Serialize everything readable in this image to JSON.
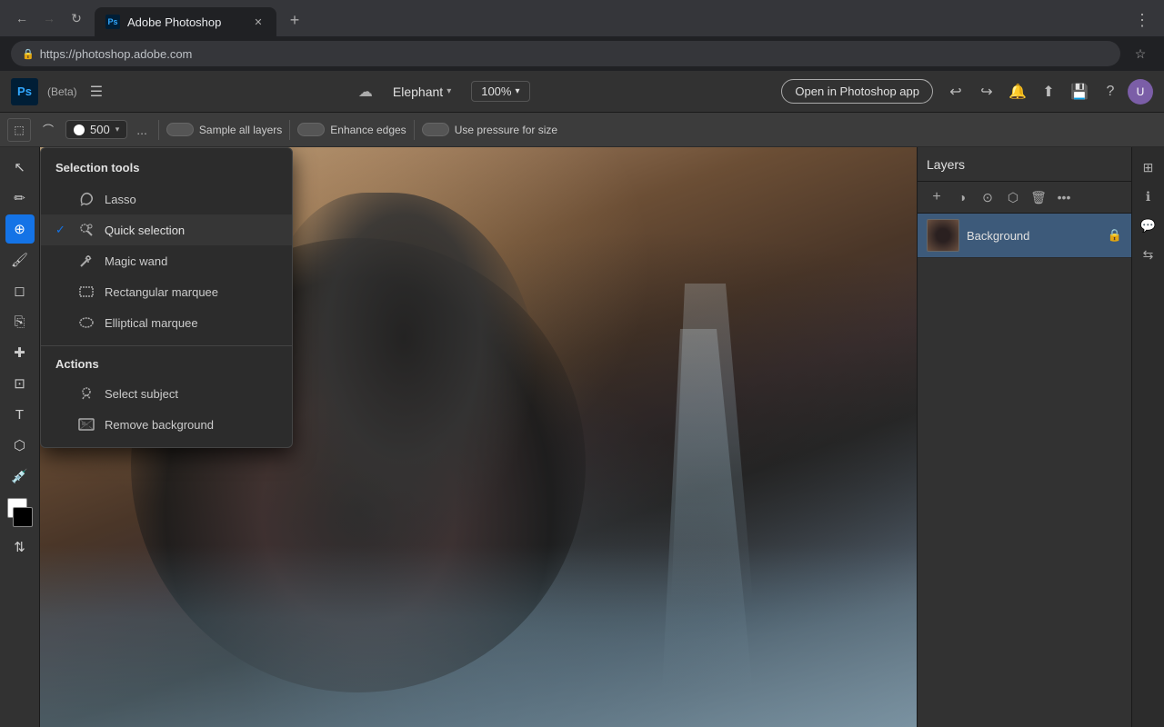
{
  "browser": {
    "tab_title": "Adobe Photoshop",
    "tab_favicon": "Ps",
    "url": "https://photoshop.adobe.com",
    "new_tab_label": "+"
  },
  "app_header": {
    "ps_logo": "Ps",
    "beta_label": "(Beta)",
    "menu_icon": "☰",
    "cloud_icon": "☁",
    "file_name": "Elephant",
    "zoom_level": "100%",
    "open_in_photoshop": "Open in Photoshop app",
    "undo_icon": "↩",
    "redo_icon": "↪"
  },
  "toolbar": {
    "brush_size": "500",
    "more_options": "...",
    "sample_all_layers_label": "Sample all layers",
    "enhance_edges_label": "Enhance edges",
    "use_pressure_label": "Use pressure for size"
  },
  "selection_dropdown": {
    "section_title": "Selection tools",
    "items": [
      {
        "name": "Lasso",
        "icon": "lasso",
        "checked": false
      },
      {
        "name": "Quick selection",
        "icon": "quick-sel",
        "checked": true
      },
      {
        "name": "Magic wand",
        "icon": "wand",
        "checked": false
      },
      {
        "name": "Rectangular marquee",
        "icon": "rect",
        "checked": false
      },
      {
        "name": "Elliptical marquee",
        "icon": "ellipse",
        "checked": false
      }
    ],
    "actions_title": "Actions",
    "actions": [
      {
        "name": "Select subject",
        "icon": "subject"
      },
      {
        "name": "Remove background",
        "icon": "bg-remove"
      }
    ]
  },
  "layers_panel": {
    "title": "Layers",
    "layer": {
      "name": "Background",
      "locked": true
    }
  },
  "colors": {
    "active_tool_bg": "#1473e6",
    "panel_bg": "#323232",
    "toolbar_bg": "#3c3c3c",
    "dropdown_bg": "#2c2c2c",
    "selected_layer_bg": "#3d5a7a"
  }
}
